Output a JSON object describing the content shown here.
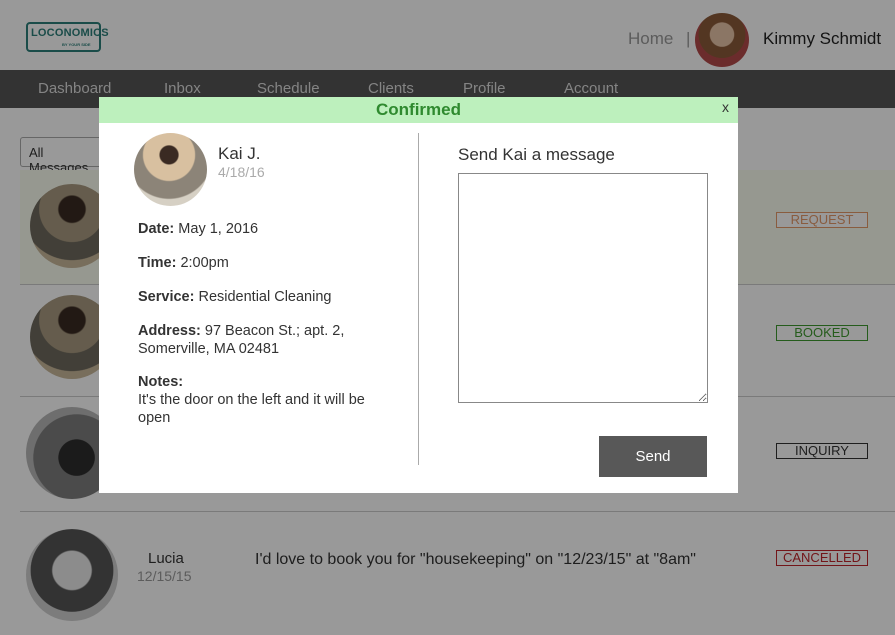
{
  "header": {
    "logo_text": "LOCONOMICS",
    "logo_subtext": "BY YOUR SIDE",
    "home_link": "Home",
    "divider": "|",
    "user_name": "Kimmy Schmidt"
  },
  "nav": {
    "items": [
      "Dashboard",
      "Inbox",
      "Schedule",
      "Clients",
      "Profile",
      "Account"
    ]
  },
  "inbox": {
    "filter_selected": "All Messages",
    "rows": [
      {
        "status": "REQUEST"
      },
      {
        "status": "BOOKED"
      },
      {
        "status": "INQUIRY"
      },
      {
        "name": "Lucia",
        "date": "12/15/15",
        "message": "I'd love to book you for \"housekeeping\" on \"12/23/15\" at \"8am\"",
        "status": "CANCELLED"
      }
    ]
  },
  "modal": {
    "title": "Confirmed",
    "close_label": "x",
    "client": {
      "name": "Kai J.",
      "date": "4/18/16"
    },
    "details": {
      "date_label": "Date:",
      "date_value": "May 1, 2016",
      "time_label": "Time:",
      "time_value": "2:00pm",
      "service_label": "Service:",
      "service_value": "Residential Cleaning",
      "address_label": "Address:",
      "address_line1": "97 Beacon St.; apt. 2,",
      "address_line2": "Somerville, MA 02481",
      "notes_label": "Notes:",
      "notes_value": "It's the door on the left and it will be open"
    },
    "message_title": "Send Kai a message",
    "message_value": "",
    "send_label": "Send"
  },
  "colors": {
    "header_bg": "#bdf0bd",
    "confirmed_text": "#2f8a2f",
    "nav_bg": "#555555",
    "request": "#e49a6a",
    "booked": "#3f9a2f",
    "cancelled": "#c0242b",
    "send_bg": "#585858"
  }
}
